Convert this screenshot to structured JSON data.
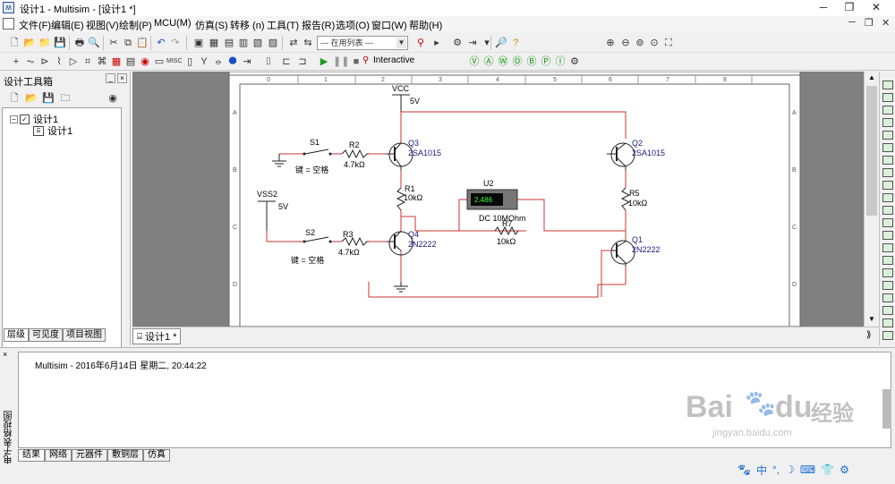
{
  "window": {
    "title": "设计1 - Multisim - [设计1 *]",
    "app_icon": "multisim-icon"
  },
  "menu": [
    "文件(F)",
    "编辑(E)",
    "视图(V)",
    "绘制(P)",
    "MCU(M)",
    "仿真(S)",
    "转移 (n)",
    "工具(T)",
    "报告(R)",
    "选项(O)",
    "窗口(W)",
    "帮助(H)"
  ],
  "toolbar": {
    "in_use_list_placeholder": "--- 在用列表 ---",
    "interactive_label": "Interactive"
  },
  "left_panel": {
    "title": "设计工具箱",
    "tree": [
      {
        "label": "设计1",
        "level": 0
      },
      {
        "label": "设计1",
        "level": 1
      }
    ],
    "tabs": [
      "层级",
      "可见度",
      "项目视图"
    ]
  },
  "sheet": {
    "col_labels": [
      "0",
      "1",
      "2",
      "3",
      "4",
      "5",
      "6",
      "7",
      "8"
    ],
    "row_labels": [
      "A",
      "B",
      "C",
      "D"
    ]
  },
  "schematic": {
    "vcc": {
      "name": "VCC",
      "value": "5V"
    },
    "vss": {
      "name": "VSS2",
      "value": "5V"
    },
    "s1": {
      "name": "S1",
      "key": "键 = 空格"
    },
    "s2": {
      "name": "S2",
      "key": "键 = 空格"
    },
    "r1": {
      "name": "R1",
      "value": "10kΩ"
    },
    "r2": {
      "name": "R2",
      "value": "4.7kΩ"
    },
    "r3": {
      "name": "R3",
      "value": "4.7kΩ"
    },
    "r5": {
      "name": "R5",
      "value": "10kΩ"
    },
    "r7": {
      "name": "R7",
      "value": "10kΩ"
    },
    "q1": {
      "name": "Q1",
      "model": "2N2222"
    },
    "q2": {
      "name": "Q2",
      "model": "2SA1015"
    },
    "q3": {
      "name": "Q3",
      "model": "2SA1015"
    },
    "q4": {
      "name": "Q4",
      "model": "2N2222"
    },
    "u2": {
      "name": "U2",
      "reading": "2.486",
      "mode": "DC  10MOhm"
    }
  },
  "canvas_tab": {
    "label": "设计1 *"
  },
  "output": {
    "message": "Multisim  -  2016年6月14日 星期二, 20:44:22",
    "side_label": "电子表格视图",
    "tabs": [
      "结果",
      "网络",
      "元器件",
      "敷铜层",
      "仿真"
    ]
  },
  "watermark": {
    "brand": "Bai",
    "brand2": "du",
    "cn": "经验",
    "url": "jingyan.baidu.com"
  },
  "taskbar": {
    "ime": "中"
  },
  "colors": {
    "wire": "#cc3333",
    "component_label": "#1a1a80",
    "canvas_bg": "#808080"
  }
}
